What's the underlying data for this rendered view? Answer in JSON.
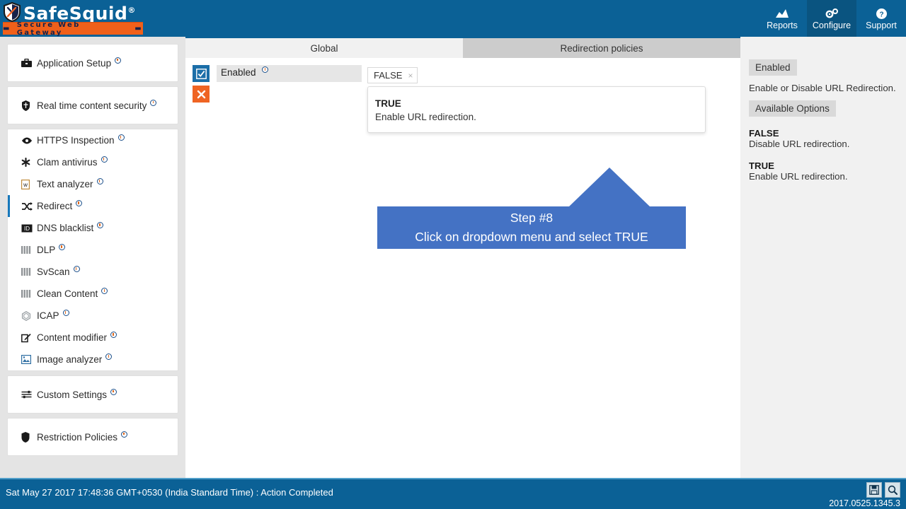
{
  "header": {
    "logo_text": "SafeSquid",
    "logo_reg": "®",
    "logo_tagline": "Secure Web Gateway",
    "nav": [
      {
        "label": "Reports",
        "icon": "chart-icon",
        "active": false
      },
      {
        "label": "Configure",
        "icon": "gears-icon",
        "active": true
      },
      {
        "label": "Support",
        "icon": "question-circle-icon",
        "active": false
      }
    ]
  },
  "sidebar": {
    "groups": [
      {
        "items": [
          {
            "label": "Application Setup",
            "icon": "briefcase-icon",
            "badge": "info",
            "active": false
          }
        ]
      },
      {
        "items": [
          {
            "label": "Real time content security",
            "icon": "security-icon",
            "badge": "info",
            "active": false
          }
        ]
      },
      {
        "items": [
          {
            "label": "HTTPS Inspection",
            "icon": "eye-icon",
            "badge": "info",
            "active": false
          },
          {
            "label": "Clam antivirus",
            "icon": "asterisk-icon",
            "badge": "info",
            "active": false
          },
          {
            "label": "Text analyzer",
            "icon": "document-icon",
            "badge": "info",
            "active": false
          },
          {
            "label": "Redirect",
            "icon": "shuffle-icon",
            "badge": "info",
            "active": true
          },
          {
            "label": "DNS blacklist",
            "icon": "dns-icon",
            "badge": "info",
            "active": false
          },
          {
            "label": "DLP",
            "icon": "bars-icon",
            "badge": "info",
            "active": false
          },
          {
            "label": "SvScan",
            "icon": "bars-icon",
            "badge": "info",
            "active": false
          },
          {
            "label": "Clean Content",
            "icon": "bars-icon",
            "badge": "info",
            "active": false
          },
          {
            "label": "ICAP",
            "icon": "hexagon-icon",
            "badge": "info",
            "active": false
          },
          {
            "label": "Content modifier",
            "icon": "edit-square-icon",
            "badge": "info",
            "active": false
          },
          {
            "label": "Image analyzer",
            "icon": "image-icon",
            "badge": "info",
            "active": false
          }
        ]
      },
      {
        "items": [
          {
            "label": "Custom Settings",
            "icon": "sliders-icon",
            "badge": "info",
            "active": false
          }
        ]
      },
      {
        "items": [
          {
            "label": "Restriction Policies",
            "icon": "shield-icon",
            "badge": "info",
            "active": false
          }
        ]
      }
    ]
  },
  "main": {
    "tabs": [
      {
        "label": "Global",
        "active": true
      },
      {
        "label": "Redirection policies",
        "active": false
      }
    ],
    "row": {
      "checkbox_icon": "checked-box-icon",
      "delete_icon": "cross-icon",
      "field_label": "Enabled",
      "selected_value": "FALSE",
      "tag_remove": "×"
    },
    "dropdown": {
      "option_title": "TRUE",
      "option_desc": "Enable URL redirection."
    }
  },
  "callout": {
    "line1": "Step #8",
    "line2": "Click on dropdown menu and select TRUE",
    "color": "#4472c4"
  },
  "right_panel": {
    "title_chip": "Enabled",
    "description": "Enable or Disable URL Redirection.",
    "options_chip": "Available Options",
    "options": [
      {
        "name": "FALSE",
        "desc": "Disable URL redirection."
      },
      {
        "name": "TRUE",
        "desc": "Enable URL redirection."
      }
    ]
  },
  "footer": {
    "status": "Sat May 27 2017 17:48:36 GMT+0530 (India Standard Time) : Action Completed",
    "save_icon": "floppy-disk-icon",
    "search_icon": "magnifier-icon",
    "version": "2017.0525.1345.3"
  },
  "colors": {
    "brand_blue": "#0b6196",
    "accent_orange": "#ef6423",
    "callout_blue": "#4472c4",
    "active_tab": "#f1f1f1",
    "inactive_tab": "#cccccc"
  }
}
